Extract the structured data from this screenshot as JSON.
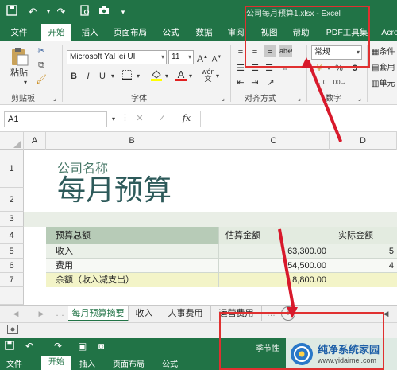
{
  "titlebar": {
    "title": "公司每月预算1.xlsx - Excel"
  },
  "tabs": [
    "文件",
    "开始",
    "插入",
    "页面布局",
    "公式",
    "数据",
    "审阅",
    "视图",
    "帮助",
    "PDF工具集",
    "Acro"
  ],
  "ribbon": {
    "clipboard_label": "剪贴板",
    "paste_label": "粘贴",
    "font_label": "字体",
    "font_name": "Microsoft YaHei UI",
    "font_size": "11",
    "bold": "B",
    "italic": "I",
    "underline": "U",
    "align_label": "对齐方式",
    "number_label": "数字",
    "number_format": "常规",
    "percent": "%",
    "comma": "9",
    "cond1": "条件",
    "cond2": "套用",
    "cond3": "单元"
  },
  "formula_bar": {
    "name_box": "A1",
    "fx": "fx"
  },
  "columns": [
    "A",
    "B",
    "C",
    "D"
  ],
  "rows": [
    "1",
    "2",
    "3",
    "4",
    "5",
    "6",
    "7"
  ],
  "sheet": {
    "company": "公司名称",
    "title": "每月预算",
    "header_total": "预算总额",
    "header_est": "估算金额",
    "header_actual": "实际金额",
    "r5_label": "收入",
    "r5_est": "63,300.00",
    "r5_act": "5",
    "r6_label": "费用",
    "r6_est": "54,500.00",
    "r6_act": "4",
    "r7_label": "余额（收入减支出）",
    "r7_est": "8,800.00"
  },
  "sheet_tabs": [
    "每月预算摘要",
    "收入",
    "人事费用",
    "运营费用"
  ],
  "bottom": {
    "title": "季节性",
    "tabs": [
      "文件",
      "开始",
      "插入",
      "页面布局",
      "公式"
    ],
    "watermark_text": "纯净系统家园",
    "watermark_url": "www.yidaimei.com"
  }
}
